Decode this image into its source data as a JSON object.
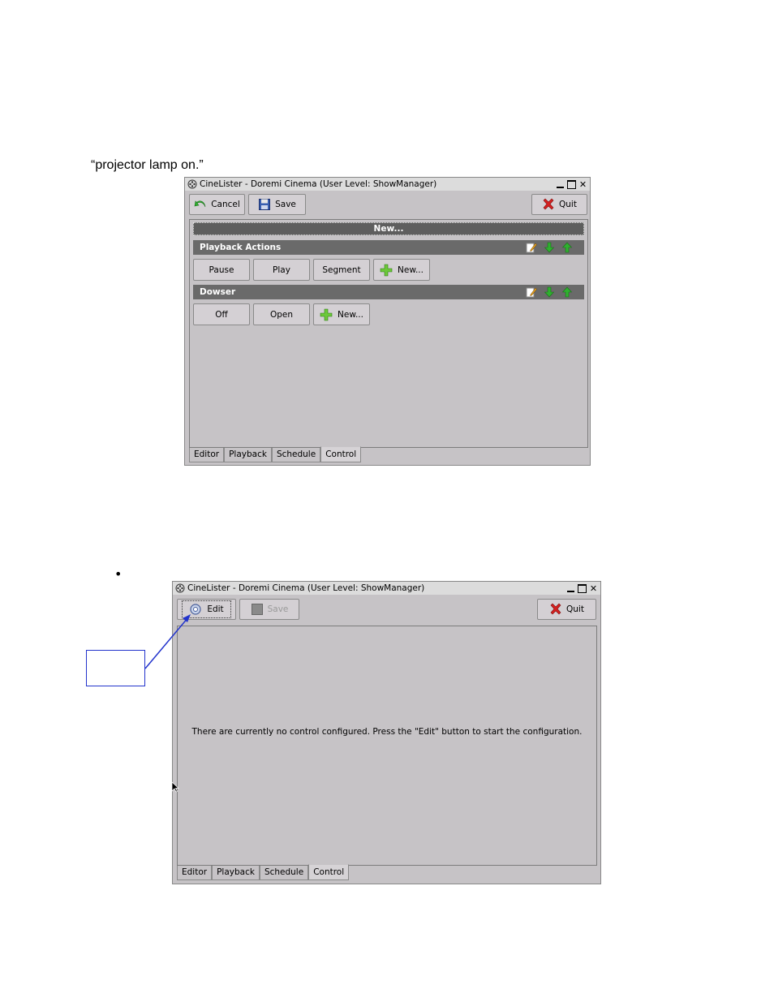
{
  "doc": {
    "caption": "“projector lamp on.”",
    "bullet": "•"
  },
  "window1": {
    "title": "CineLister - Doremi Cinema (User Level: ShowManager)",
    "toolbar": {
      "cancel": "Cancel",
      "save": "Save",
      "quit": "Quit"
    },
    "new_bar": "New...",
    "sections": [
      {
        "title": "Playback Actions",
        "buttons": [
          "Pause",
          "Play",
          "Segment"
        ],
        "new_label": "New..."
      },
      {
        "title": "Dowser",
        "buttons": [
          "Off",
          "Open"
        ],
        "new_label": "New..."
      }
    ],
    "tabs": [
      "Editor",
      "Playback",
      "Schedule",
      "Control"
    ],
    "active_tab": "Control"
  },
  "window2": {
    "title": "CineLister - Doremi Cinema (User Level: ShowManager)",
    "toolbar": {
      "edit": "Edit",
      "save": "Save",
      "quit": "Quit"
    },
    "message": "There are currently no control configured. Press the \"Edit\" button to start the configuration.",
    "tabs": [
      "Editor",
      "Playback",
      "Schedule",
      "Control"
    ],
    "active_tab": "Control"
  },
  "colors": {
    "window_bg": "#c6c3c6",
    "section_bg": "#6a6a6a",
    "arrow_green": "#2fb02f",
    "quit_red": "#d42020",
    "callout_blue": "#2233cc"
  },
  "icons": {
    "app": "film-reel-icon",
    "cancel": "green-undo-arrow-icon",
    "save": "floppy-disk-icon",
    "quit": "red-x-icon",
    "new": "green-plus-icon",
    "edit_section": "edit-pencil-icon",
    "move_down": "green-down-arrow-icon",
    "move_up": "green-up-arrow-icon",
    "edit": "edit-gear-icon"
  }
}
